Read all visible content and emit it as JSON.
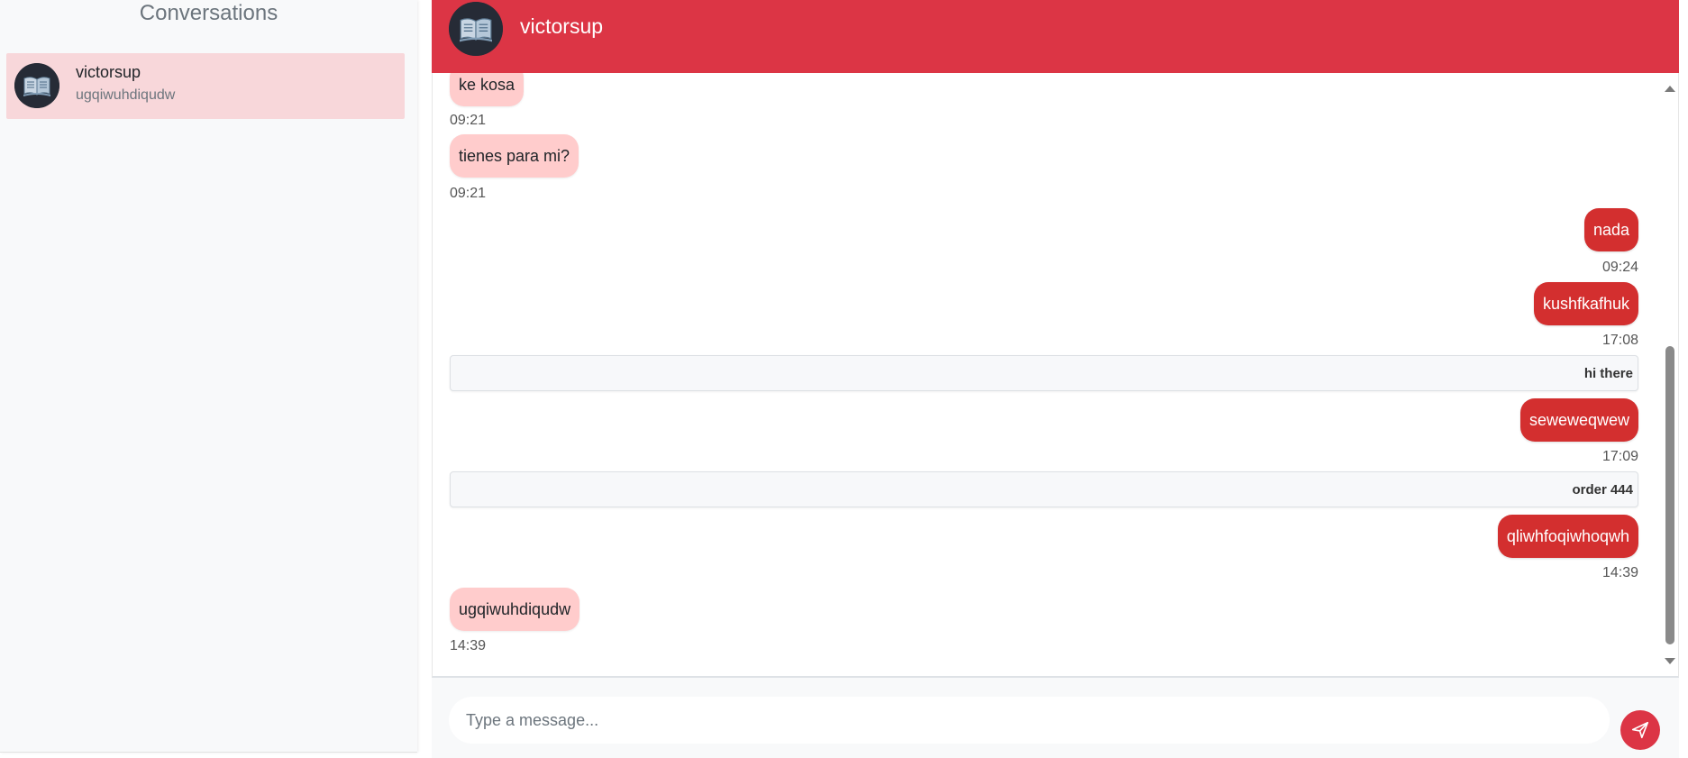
{
  "sidebar": {
    "title": "Conversations",
    "conversations": [
      {
        "name": "victorsup",
        "last_message": "ugqiwuhdiqudw"
      }
    ]
  },
  "chat": {
    "header": {
      "name": "victorsup"
    },
    "messages": [
      {
        "direction": "in",
        "text": "ke kosa",
        "time": "09:21"
      },
      {
        "direction": "in",
        "text": "tienes para mi?",
        "time": "09:21"
      },
      {
        "direction": "out",
        "text": "nada",
        "time": "09:24"
      },
      {
        "direction": "out",
        "text": "kushfkafhuk",
        "time": "17:08"
      },
      {
        "direction": "system",
        "text": "hi there"
      },
      {
        "direction": "out",
        "text": "seweweqwew",
        "time": "17:09"
      },
      {
        "direction": "system",
        "text": "order 444"
      },
      {
        "direction": "out",
        "text": "qliwhfoqiwhoqwh",
        "time": "14:39"
      },
      {
        "direction": "in",
        "text": "ugqiwuhdiqudw",
        "time": "14:39"
      }
    ],
    "input": {
      "placeholder": "Type a message..."
    }
  },
  "colors": {
    "accent": "#dc3545",
    "outgoing_bubble": "#d32f2f",
    "incoming_bubble": "#ffcccc",
    "selected_conversation": "#f8d7da"
  }
}
